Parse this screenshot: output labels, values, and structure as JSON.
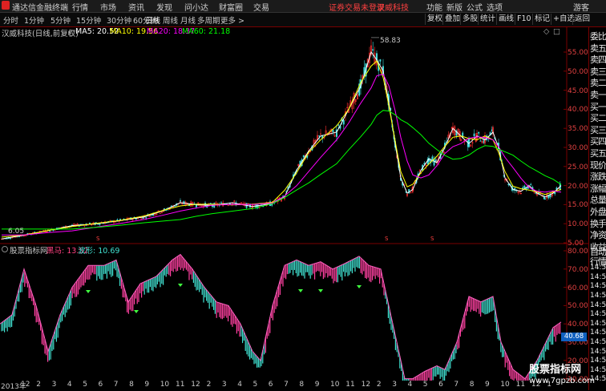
{
  "menu": {
    "app_title": "通达信金融终端",
    "items": [
      "行情",
      "市场",
      "资讯",
      "发现",
      "问小达",
      "财富圈",
      "交易"
    ],
    "login_status": "证券交易未登录",
    "stock_name": "汉威科技",
    "right_items": [
      "功能",
      "新版",
      "公式",
      "选项",
      "游客"
    ]
  },
  "toolbar": {
    "periods": [
      "分时",
      "1分钟",
      "5分钟",
      "15分钟",
      "30分钟",
      "60分钟",
      "日线",
      "周线",
      "月线",
      "多周期",
      "更多 >"
    ],
    "active_period": "日线",
    "buttons": [
      "复权",
      "叠加",
      "多股",
      "统计",
      "画线",
      "F10",
      "标记",
      "+自选",
      "返回"
    ]
  },
  "info": {
    "title": "汉威科技(日线,前复权)",
    "ma5": "MA5: 20.52",
    "ma10": "MA10: 19.56",
    "ma20": "MA20: 18.37",
    "ma60": "MA60: 21.18",
    "colors": {
      "ma5": "#ffffff",
      "ma10": "#ffff00",
      "ma20": "#ff00ff",
      "ma60": "#00ff00"
    }
  },
  "price_axis": [
    "55.00",
    "50.00",
    "45.00",
    "40.00",
    "35.00",
    "30.00",
    "25.00",
    "20.00",
    "15.00",
    "10.00",
    "5.00"
  ],
  "price_annotations": {
    "high": "58.83",
    "low": "6.05"
  },
  "indicator": {
    "name": "股票指标网",
    "line1": "黑马: 13.52",
    "line2": "波形: 10.69",
    "axis": [
      "80.00",
      "70.00",
      "60.00",
      "50.00",
      "40.00",
      "30.00",
      "20.00",
      "10.00"
    ],
    "current_value": "40.68"
  },
  "right_panel": [
    "委比",
    "卖五",
    "卖四",
    "卖三",
    "卖二",
    "卖一",
    "买一",
    "买二",
    "买三",
    "买四",
    "买五",
    "现价",
    "涨跌",
    "涨幅",
    "总量",
    "外盘",
    "换手",
    "净资",
    "收益"
  ],
  "right_panel_bottom": [
    "自动",
    "行情",
    "14:50",
    "14:50",
    "14:50",
    "14:50",
    "14:50",
    "14:50",
    "14:50",
    "14:50",
    "14:50",
    "14:50",
    "14:50",
    "14:50",
    "14:50"
  ],
  "x_axis": [
    "2013年",
    "12",
    "2",
    "3",
    "4",
    "5",
    "6",
    "7",
    "8",
    "9",
    "10",
    "11",
    "12",
    "2",
    "3",
    "4",
    "5",
    "6",
    "7",
    "8",
    "9",
    "10",
    "11",
    "12",
    "2",
    "3",
    "4",
    "5",
    "6",
    "7",
    "8",
    "9",
    "10",
    "11",
    "12",
    "1"
  ],
  "watermark": {
    "title": "股票指标网",
    "url": "www.7gpzb.com"
  }
}
